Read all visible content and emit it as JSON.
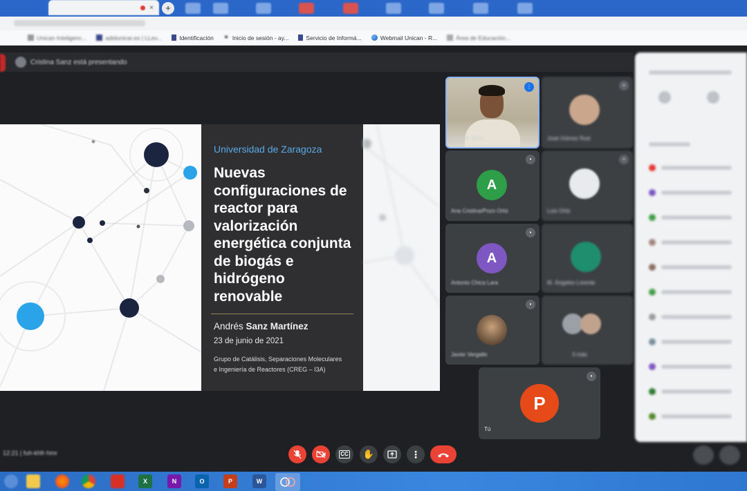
{
  "browser": {
    "bookmarks": [
      {
        "label": "Identificación",
        "icon": "university-icon"
      },
      {
        "label": "Inicio de sesión - ay...",
        "icon": "asterisk-icon"
      },
      {
        "label": "Servicio de Informá...",
        "icon": "university-icon"
      },
      {
        "label": "Webmail Unican - R...",
        "icon": "globe-icon"
      }
    ]
  },
  "slide": {
    "university": "Universidad de Zaragoza",
    "title": "Nuevas configuraciones de reactor para valorización energética conjunta de biogás e hidrógeno renovable",
    "author_first": "Andrés ",
    "author_last": "Sanz Martínez",
    "date": "23 de junio de 2021",
    "group_line1": "Grupo de Catálisis, Separaciones Moleculares",
    "group_line2": "e Ingeniería de Reactores (CREG – I3A)"
  },
  "participants": [
    {
      "name": "Ana Cristina/Pozo Ortiz",
      "initial": "A",
      "color": "#2e9e48"
    },
    {
      "name": "Antonio Chica Lara",
      "initial": "A",
      "color": "#7e57c2"
    },
    {
      "name": "Javier Vergallo",
      "initial": "",
      "color": "#5f6368"
    },
    {
      "name": "Tú",
      "initial": "P",
      "color": "#e64a19"
    }
  ],
  "controls": {
    "mic": "mic-off-icon",
    "camera": "camera-off-icon",
    "captions_label": "CC",
    "hand": "raise-hand-icon",
    "present": "present-icon",
    "more": "more-icon",
    "hangup": "hang-up-icon"
  },
  "taskbar": {
    "apps": [
      "file-explorer",
      "firefox",
      "chrome",
      "acrobat",
      "excel",
      "onenote",
      "outlook",
      "powerpoint",
      "word",
      "snipping-tool"
    ],
    "labels": {
      "excel": "X",
      "onenote": "N",
      "outlook": "O",
      "powerpoint": "P",
      "word": "W"
    }
  }
}
